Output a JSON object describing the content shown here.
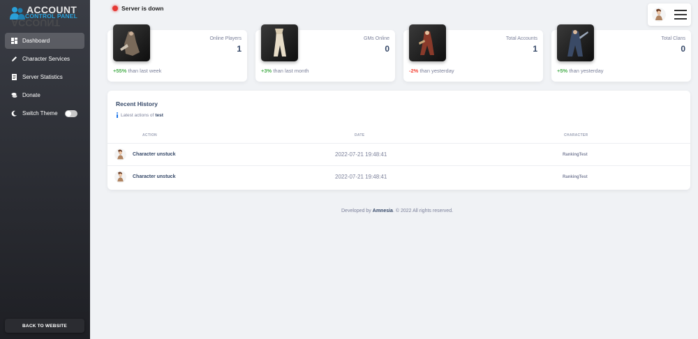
{
  "logo": {
    "title": "ACCOUNT",
    "subtitle": "CONTROL PANEL",
    "reflection": "ACCOUNT"
  },
  "sidebar": {
    "items": [
      {
        "label": "Dashboard",
        "icon": "dashboard-icon",
        "active": true
      },
      {
        "label": "Character Services",
        "icon": "pencil-icon"
      },
      {
        "label": "Server Statistics",
        "icon": "document-icon"
      },
      {
        "label": "Donate",
        "icon": "coins-icon"
      },
      {
        "label": "Switch Theme",
        "icon": "moon-icon"
      }
    ],
    "back_label": "BACK TO WEBSITE"
  },
  "status": {
    "text": "Server is down",
    "color": "#e53935"
  },
  "stats": [
    {
      "label": "Online Players",
      "value": "1",
      "change": "+55%",
      "change_text": " than last week",
      "trend": "positive"
    },
    {
      "label": "GMs Online",
      "value": "0",
      "change": "+3%",
      "change_text": " than last month",
      "trend": "positive"
    },
    {
      "label": "Total Accounts",
      "value": "1",
      "change": "-2%",
      "change_text": " than yesterday",
      "trend": "negative"
    },
    {
      "label": "Total Clans",
      "value": "0",
      "change": "+5%",
      "change_text": " than yesterday",
      "trend": "positive"
    }
  ],
  "history": {
    "title": "Recent History",
    "subtitle_prefix": "Latest actions of",
    "subtitle_user": "test",
    "columns": [
      "ACTION",
      "DATE",
      "CHARACTER"
    ],
    "rows": [
      {
        "action": "Character unstuck",
        "date": "2022-07-21 19:48:41",
        "character": "RankingTest"
      },
      {
        "action": "Character unstuck",
        "date": "2022-07-21 19:48:41",
        "character": "RankingTest"
      }
    ]
  },
  "footer": {
    "prefix": "Developed by",
    "author": "Amnesia",
    "suffix": ". © 2022 All rights reserved."
  },
  "colors": {
    "accent": "#2a9fd8",
    "positive": "#4caf50",
    "negative": "#f44335"
  }
}
